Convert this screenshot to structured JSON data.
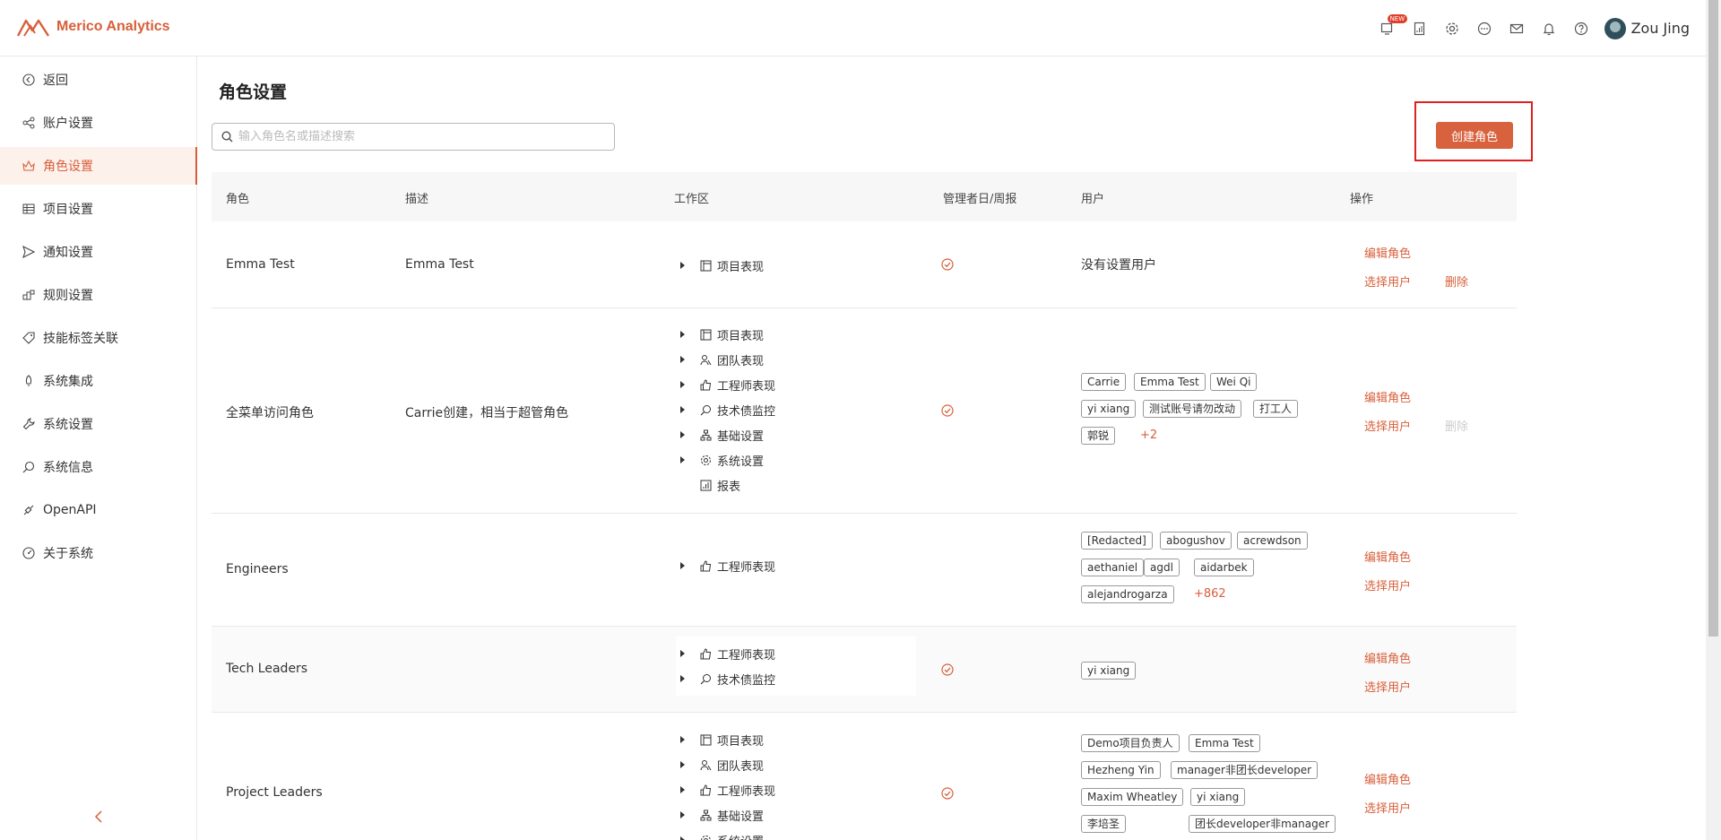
{
  "header": {
    "brand": "Merico Analytics",
    "new_badge": "NEW",
    "username": "Zou Jing",
    "icons": [
      "screen-new-icon",
      "report-icon",
      "gear-icon",
      "chat-icon",
      "mail-icon",
      "bell-icon",
      "help-icon"
    ]
  },
  "sidebar": {
    "items": [
      {
        "label": "返回",
        "icon": "back-icon"
      },
      {
        "label": "账户设置",
        "icon": "account-icon"
      },
      {
        "label": "角色设置",
        "icon": "role-icon",
        "active": true
      },
      {
        "label": "项目设置",
        "icon": "table-icon"
      },
      {
        "label": "通知设置",
        "icon": "send-icon"
      },
      {
        "label": "规则设置",
        "icon": "rules-icon"
      },
      {
        "label": "技能标签关联",
        "icon": "tag-icon"
      },
      {
        "label": "系统集成",
        "icon": "rocket-icon"
      },
      {
        "label": "系统设置",
        "icon": "wrench-icon"
      },
      {
        "label": "系统信息",
        "icon": "search-info-icon"
      },
      {
        "label": "OpenAPI",
        "icon": "api-icon"
      },
      {
        "label": "关于系统",
        "icon": "dashboard-icon"
      }
    ]
  },
  "main": {
    "title": "角色设置",
    "search_placeholder": "输入角色名或描述搜索",
    "create_button": "创建角色",
    "columns": [
      "角色",
      "描述",
      "工作区",
      "管理者日/周报",
      "用户",
      "操作"
    ],
    "actions": {
      "edit": "编辑角色",
      "select_users": "选择用户",
      "delete": "删除"
    },
    "rows": [
      {
        "role": "Emma Test",
        "description": "Emma Test",
        "workspaces": [
          {
            "label": "项目表现",
            "icon": "project-icon",
            "expand": true
          }
        ],
        "report": true,
        "users_text": "没有设置用户",
        "users": [],
        "more": "",
        "delete_enabled": true
      },
      {
        "role": "全菜单访问角色",
        "description": "Carrie创建，相当于超管角色",
        "workspaces": [
          {
            "label": "项目表现",
            "icon": "project-icon",
            "expand": true
          },
          {
            "label": "团队表现",
            "icon": "team-icon",
            "expand": true
          },
          {
            "label": "工程师表现",
            "icon": "thumb-icon",
            "expand": true
          },
          {
            "label": "技术债监控",
            "icon": "debt-icon",
            "expand": true
          },
          {
            "label": "基础设置",
            "icon": "org-icon",
            "expand": true
          },
          {
            "label": "系统设置",
            "icon": "gear-icon",
            "expand": true
          },
          {
            "label": "报表",
            "icon": "report-icon",
            "expand": false
          }
        ],
        "report": true,
        "users_text": "",
        "users": [
          "Carrie",
          "Emma Test",
          "Wei Qi",
          "yi xiang",
          "测试账号请勿改动",
          "打工人",
          "郭锐"
        ],
        "more": "+2",
        "delete_enabled": false
      },
      {
        "role": "Engineers",
        "description": "",
        "workspaces": [
          {
            "label": "工程师表现",
            "icon": "thumb-icon",
            "expand": true
          }
        ],
        "report": false,
        "users_text": "",
        "users": [
          "[Redacted]",
          "abogushov",
          "acrewdson",
          "aethaniel",
          "agdl",
          "aidarbek",
          "alejandrogarza"
        ],
        "more": "+862",
        "delete_enabled": false
      },
      {
        "role": "Tech Leaders",
        "description": "",
        "workspaces": [
          {
            "label": "工程师表现",
            "icon": "thumb-icon",
            "expand": true
          },
          {
            "label": "技术债监控",
            "icon": "debt-icon",
            "expand": true
          }
        ],
        "report": true,
        "users_text": "",
        "users": [
          "yi xiang"
        ],
        "more": "",
        "delete_enabled": false
      },
      {
        "role": "Project Leaders",
        "description": "",
        "workspaces": [
          {
            "label": "项目表现",
            "icon": "project-icon",
            "expand": true
          },
          {
            "label": "团队表现",
            "icon": "team-icon",
            "expand": true
          },
          {
            "label": "工程师表现",
            "icon": "thumb-icon",
            "expand": true
          },
          {
            "label": "基础设置",
            "icon": "org-icon",
            "expand": true
          },
          {
            "label": "系统设置",
            "icon": "gear-icon",
            "expand": true
          }
        ],
        "report": true,
        "users_text": "",
        "users": [
          "Demo项目负责人",
          "Emma Test",
          "Hezheng Yin",
          "manager非团长developer",
          "Maxim Wheatley",
          "yi xiang",
          "李培圣",
          "团长developer非manager"
        ],
        "more": "",
        "delete_enabled": false
      }
    ]
  },
  "colors": {
    "accent": "#d85f3a",
    "highlight_border": "#e02020"
  }
}
